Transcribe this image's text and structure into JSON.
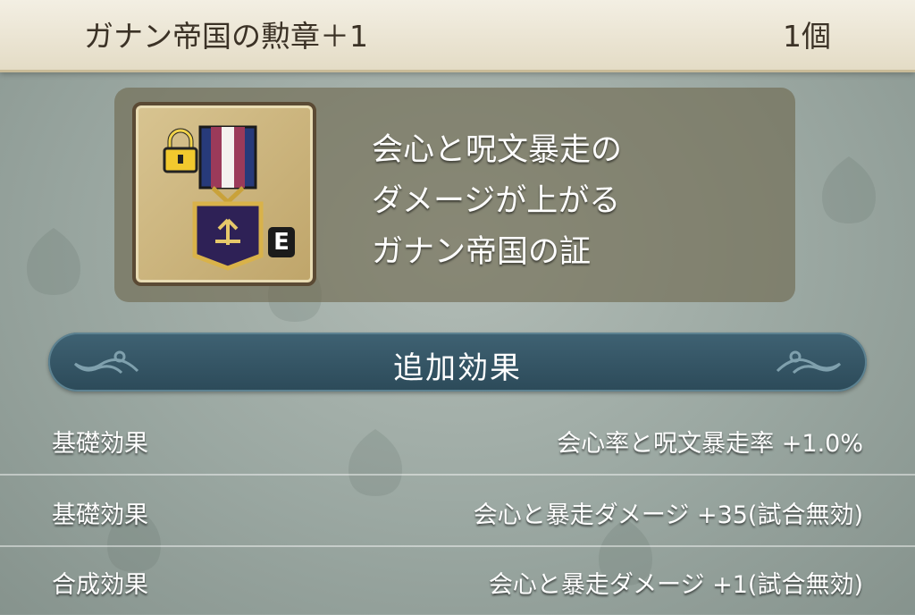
{
  "header": {
    "item_name": "ガナン帝国の勲章＋1",
    "count": "1個"
  },
  "item": {
    "equipped_badge": "E",
    "icon": "medal-icon",
    "lock_icon": "padlock-icon"
  },
  "description": {
    "lines": [
      "会心と呪文暴走の",
      "ダメージが上がる",
      "ガナン帝国の証"
    ]
  },
  "effects": {
    "section_title": "追加効果",
    "rows": [
      {
        "label": "基礎効果",
        "value": "会心率と呪文暴走率 +1.0%"
      },
      {
        "label": "基礎効果",
        "value": "会心と暴走ダメージ +35(試合無効)"
      },
      {
        "label": "合成効果",
        "value": "会心と暴走ダメージ +1(試合無効)"
      }
    ]
  },
  "colors": {
    "header_bg": "#efe9d8",
    "banner": "#35576a",
    "panel": "#6e684e"
  }
}
